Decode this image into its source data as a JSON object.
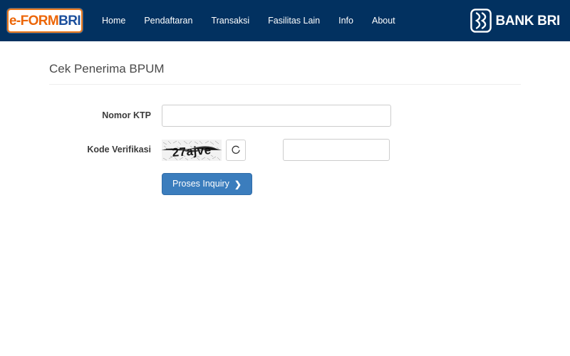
{
  "navbar": {
    "brand": {
      "part1": "e-FORM",
      "part2": "BRI"
    },
    "links": [
      {
        "label": "Home"
      },
      {
        "label": "Pendaftaran"
      },
      {
        "label": "Transaksi"
      },
      {
        "label": "Fasilitas Lain"
      },
      {
        "label": "Info"
      },
      {
        "label": "About"
      }
    ],
    "bank_logo_text": "BANK BRI",
    "background_color": "#023160"
  },
  "main": {
    "page_title": "Cek Penerima BPUM",
    "fields": {
      "ktp": {
        "label": "Nomor KTP",
        "value": "",
        "placeholder": ""
      },
      "captcha": {
        "label": "Kode Verifikasi",
        "image_text": "27ajve",
        "refresh_icon": "refresh-icon",
        "value": "",
        "placeholder": ""
      }
    },
    "submit": {
      "label": "Proses Inquiry",
      "chevron": "❯",
      "color": "#3b7dbd"
    }
  }
}
